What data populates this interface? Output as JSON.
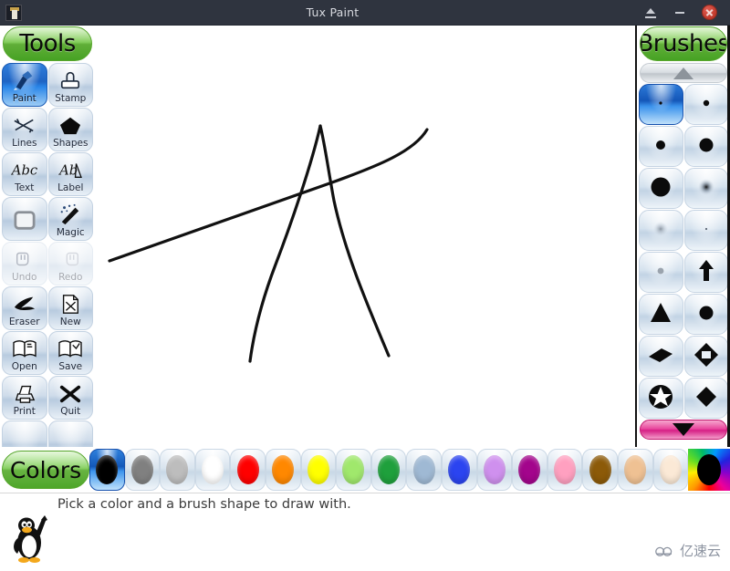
{
  "window": {
    "title": "Tux Paint",
    "app_icon": "tux-paint-icon",
    "buttons": [
      {
        "name": "eject-button",
        "label": "Eject"
      },
      {
        "name": "minimize-button",
        "label": "Minimize"
      },
      {
        "name": "close-button",
        "label": "Close"
      }
    ]
  },
  "tools": {
    "title": "Tools",
    "items": [
      {
        "label": "Paint",
        "icon": "paintbrush-icon",
        "selected": true,
        "disabled": false
      },
      {
        "label": "Stamp",
        "icon": "stamp-icon",
        "selected": false,
        "disabled": false
      },
      {
        "label": "Lines",
        "icon": "lines-icon",
        "selected": false,
        "disabled": false
      },
      {
        "label": "Shapes",
        "icon": "pentagon-icon",
        "selected": false,
        "disabled": false
      },
      {
        "label": "Text",
        "icon": "abc-text-icon",
        "selected": false,
        "disabled": false
      },
      {
        "label": "Label",
        "icon": "abc-label-icon",
        "selected": false,
        "disabled": false
      },
      {
        "label": "",
        "icon": "fill-icon",
        "selected": false,
        "disabled": false
      },
      {
        "label": "Magic",
        "icon": "magic-wand-icon",
        "selected": false,
        "disabled": false
      },
      {
        "label": "Undo",
        "icon": "undo-hand-icon",
        "selected": false,
        "disabled": true
      },
      {
        "label": "Redo",
        "icon": "redo-hand-icon",
        "selected": false,
        "disabled": true
      },
      {
        "label": "Eraser",
        "icon": "eraser-icon",
        "selected": false,
        "disabled": false
      },
      {
        "label": "New",
        "icon": "new-page-icon",
        "selected": false,
        "disabled": false
      },
      {
        "label": "Open",
        "icon": "open-book-icon",
        "selected": false,
        "disabled": false
      },
      {
        "label": "Save",
        "icon": "save-book-icon",
        "selected": false,
        "disabled": false
      },
      {
        "label": "Print",
        "icon": "printer-icon",
        "selected": false,
        "disabled": false
      },
      {
        "label": "Quit",
        "icon": "quit-x-icon",
        "selected": false,
        "disabled": false
      },
      {
        "label": "",
        "icon": "empty-slot",
        "selected": false,
        "disabled": false
      },
      {
        "label": "",
        "icon": "empty-slot",
        "selected": false,
        "disabled": false
      }
    ]
  },
  "brushes": {
    "title": "Brushes",
    "scroll_up": {
      "name": "brush-scroll-up",
      "enabled": false
    },
    "scroll_down": {
      "name": "brush-scroll-down",
      "enabled": true
    },
    "items": [
      {
        "icon": "dot-tiny-brush",
        "selected": true
      },
      {
        "icon": "dot-small-brush",
        "selected": false
      },
      {
        "icon": "dot-medium-brush",
        "selected": false
      },
      {
        "icon": "circle-large-brush",
        "selected": false
      },
      {
        "icon": "circle-xlarge-brush",
        "selected": false
      },
      {
        "icon": "fuzzy-dot-brush",
        "selected": false
      },
      {
        "icon": "soft-gray-dot-brush",
        "selected": false
      },
      {
        "icon": "tiny-speck-brush",
        "selected": false
      },
      {
        "icon": "gray-dot-brush",
        "selected": false
      },
      {
        "icon": "arrow-up-brush",
        "selected": false
      },
      {
        "icon": "triangle-brush",
        "selected": false
      },
      {
        "icon": "circle-brush",
        "selected": false
      },
      {
        "icon": "rhombus-brush",
        "selected": false
      },
      {
        "icon": "diamond-outline-brush",
        "selected": false
      },
      {
        "icon": "star-brush",
        "selected": false
      },
      {
        "icon": "diamond-brush",
        "selected": false
      }
    ]
  },
  "colors": {
    "title": "Colors",
    "swatches": [
      {
        "name": "color-black",
        "hex": "#000000",
        "selected": true
      },
      {
        "name": "color-dark-grey",
        "hex": "#808080",
        "selected": false
      },
      {
        "name": "color-light-grey",
        "hex": "#bdbdbd",
        "selected": false
      },
      {
        "name": "color-white",
        "hex": "#ffffff",
        "selected": false
      },
      {
        "name": "color-red",
        "hex": "#ff0000",
        "selected": false
      },
      {
        "name": "color-orange",
        "hex": "#ff8800",
        "selected": false
      },
      {
        "name": "color-yellow",
        "hex": "#ffff00",
        "selected": false
      },
      {
        "name": "color-light-green",
        "hex": "#a0e86c",
        "selected": false
      },
      {
        "name": "color-green",
        "hex": "#1fa03c",
        "selected": false
      },
      {
        "name": "color-cyan-blue",
        "hex": "#9fb9d4",
        "selected": false
      },
      {
        "name": "color-blue",
        "hex": "#2b44f0",
        "selected": false
      },
      {
        "name": "color-lavender",
        "hex": "#cf90ee",
        "selected": false
      },
      {
        "name": "color-magenta",
        "hex": "#a3058c",
        "selected": false
      },
      {
        "name": "color-pink",
        "hex": "#ffa0c0",
        "selected": false
      },
      {
        "name": "color-brown",
        "hex": "#8c5a09",
        "selected": false
      },
      {
        "name": "color-tan",
        "hex": "#efc193",
        "selected": false
      },
      {
        "name": "color-cream",
        "hex": "#fbe9d6",
        "selected": false
      },
      {
        "name": "color-rainbow-picker",
        "hex": "rainbow",
        "selected": false
      }
    ]
  },
  "canvas": {
    "name": "drawing-canvas",
    "background": "#ffffff",
    "stroke_color": "#111111",
    "drawing_description": "hand-drawn letter A with a long diagonal crossbar"
  },
  "status": {
    "text": "Pick a color and a brush shape to draw with.",
    "mascot": "tux-penguin-mascot"
  },
  "watermark": {
    "text": "亿速云",
    "icon": "cloud-icon"
  }
}
